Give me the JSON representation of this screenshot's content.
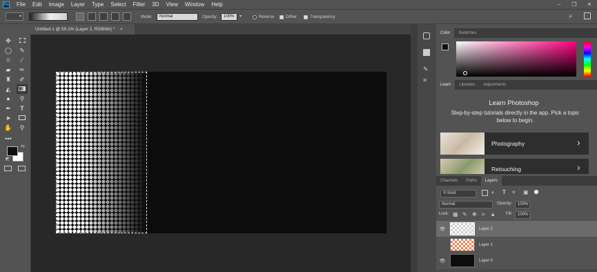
{
  "app": {
    "logo": "Ps"
  },
  "menu": [
    "File",
    "Edit",
    "Image",
    "Layer",
    "Type",
    "Select",
    "Filter",
    "3D",
    "View",
    "Window",
    "Help"
  ],
  "window_controls": [
    "–",
    "❐",
    "✕"
  ],
  "options_bar": {
    "mode_label": "Mode:",
    "mode_value": "Normal",
    "opacity_label": "Opacity:",
    "opacity_value": "100%",
    "reverse_label": "Reverse",
    "reverse_checked": false,
    "dither_label": "Dither",
    "dither_checked": true,
    "transparency_label": "Transparency",
    "transparency_checked": true
  },
  "document": {
    "tab_title": "Untitled-1 @ 55.1% (Layer 2, RGB/8#) *",
    "close_glyph": "×"
  },
  "tools": [
    "move-tool",
    "marquee-tool",
    "lasso-tool",
    "quick-select-tool",
    "crop-tool",
    "eyedropper-tool",
    "healing-tool",
    "brush-tool",
    "stamp-tool",
    "history-brush-tool",
    "eraser-tool",
    "gradient-tool",
    "blur-tool",
    "dodge-tool",
    "pen-tool",
    "type-tool",
    "path-select-tool",
    "rectangle-tool",
    "hand-tool",
    "zoom-tool",
    "more-tools"
  ],
  "colors": {
    "foreground": "#111111",
    "background": "#ffffff",
    "accent": "#31a8ff"
  },
  "color_panel": {
    "tabs": [
      "Color",
      "Swatches"
    ],
    "active": "Color"
  },
  "learn_panel": {
    "tabs": [
      "Learn",
      "Libraries",
      "Adjustments"
    ],
    "active": "Learn",
    "title": "Learn Photoshop",
    "subtitle": "Step-by-step tutorials directly in the app. Pick a topic below to begin.",
    "topics": [
      "Photography",
      "Retouching"
    ],
    "chevron": "›"
  },
  "layers_panel": {
    "tabs": [
      "Channels",
      "Paths",
      "Layers"
    ],
    "active": "Layers",
    "kind_label": "Kind",
    "blend_mode": "Normal",
    "opacity_label": "Opacity:",
    "opacity_value": "100%",
    "lock_label": "Lock:",
    "fill_label": "Fill:",
    "fill_value": "100%",
    "layers": [
      {
        "name": "Layer 2",
        "visible": true,
        "selected": true
      },
      {
        "name": "Layer 1",
        "visible": false,
        "selected": false
      },
      {
        "name": "Layer 0",
        "visible": true,
        "selected": false
      }
    ]
  }
}
